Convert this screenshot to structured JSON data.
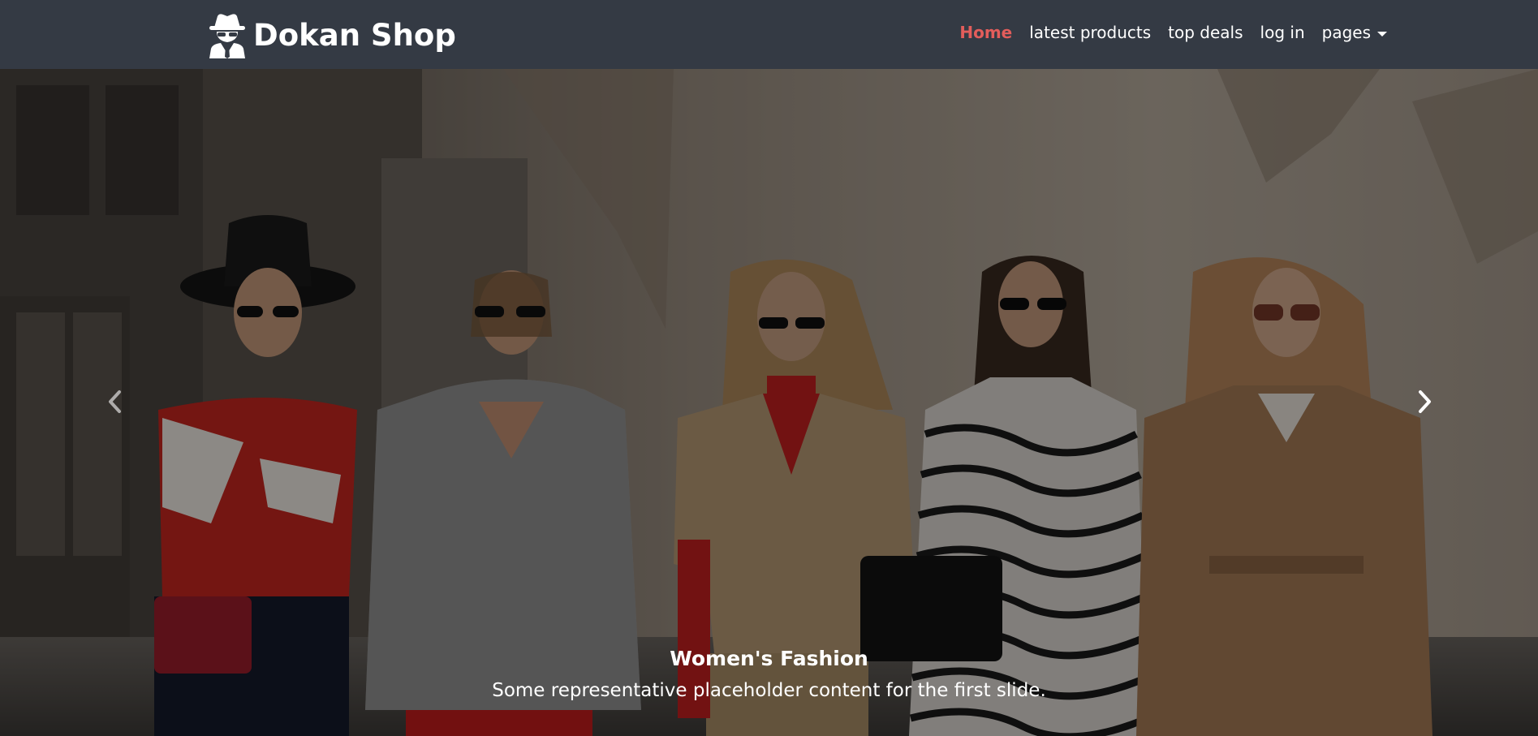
{
  "brand": {
    "name": "Dokan Shop",
    "icon": "spy-icon"
  },
  "nav": {
    "items": [
      {
        "label": "Home",
        "active": true
      },
      {
        "label": "latest products",
        "active": false
      },
      {
        "label": "top deals",
        "active": false
      },
      {
        "label": "log in",
        "active": false
      },
      {
        "label": "pages",
        "active": false,
        "dropdown": true
      }
    ]
  },
  "carousel": {
    "slide": {
      "title": "Women's Fashion",
      "text": "Some representative placeholder content for the first slide."
    },
    "prev_icon": "chevron-left-icon",
    "next_icon": "chevron-right-icon"
  },
  "colors": {
    "navbar_bg": "#343a44",
    "active_link": "#e35d5b",
    "text": "#ffffff"
  }
}
